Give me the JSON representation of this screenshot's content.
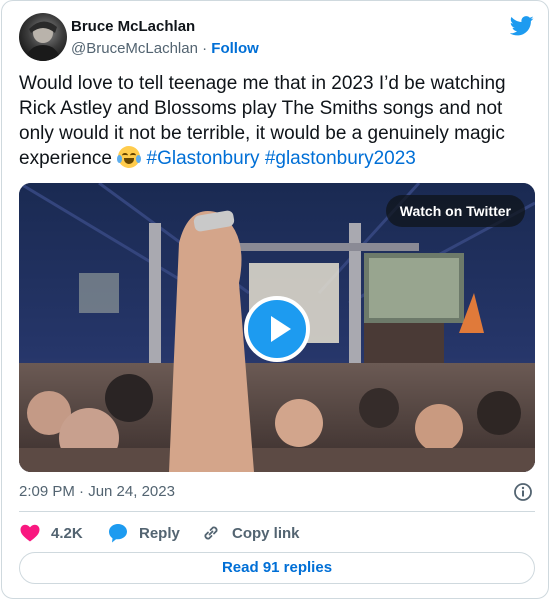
{
  "author": {
    "name": "Bruce McLachlan",
    "handle": "@BruceMcLachlan",
    "separator": "·",
    "follow_label": "Follow"
  },
  "tweet": {
    "text": "Would love to tell teenage me that in 2023 I’d be watching Rick Astley and Blossoms play The Smiths songs and not only would it not be terrible, it would be a genuinely magic experience",
    "emoji": "face-with-tears-of-joy",
    "hashtags": [
      "#Glastonbury",
      "#glastonbury2023"
    ]
  },
  "media": {
    "watch_label": "Watch on Twitter",
    "play_icon": "play-icon"
  },
  "meta": {
    "timestamp": "2:09 PM · Jun 24, 2023"
  },
  "actions": {
    "like_count": "4.2K",
    "reply_label": "Reply",
    "copy_label": "Copy link"
  },
  "read_replies_label": "Read 91 replies",
  "colors": {
    "link": "#006fd6",
    "twitter_blue": "#1d9bf0",
    "like_red": "#f91880",
    "secondary_text": "#536471",
    "border": "#cfd9de"
  }
}
